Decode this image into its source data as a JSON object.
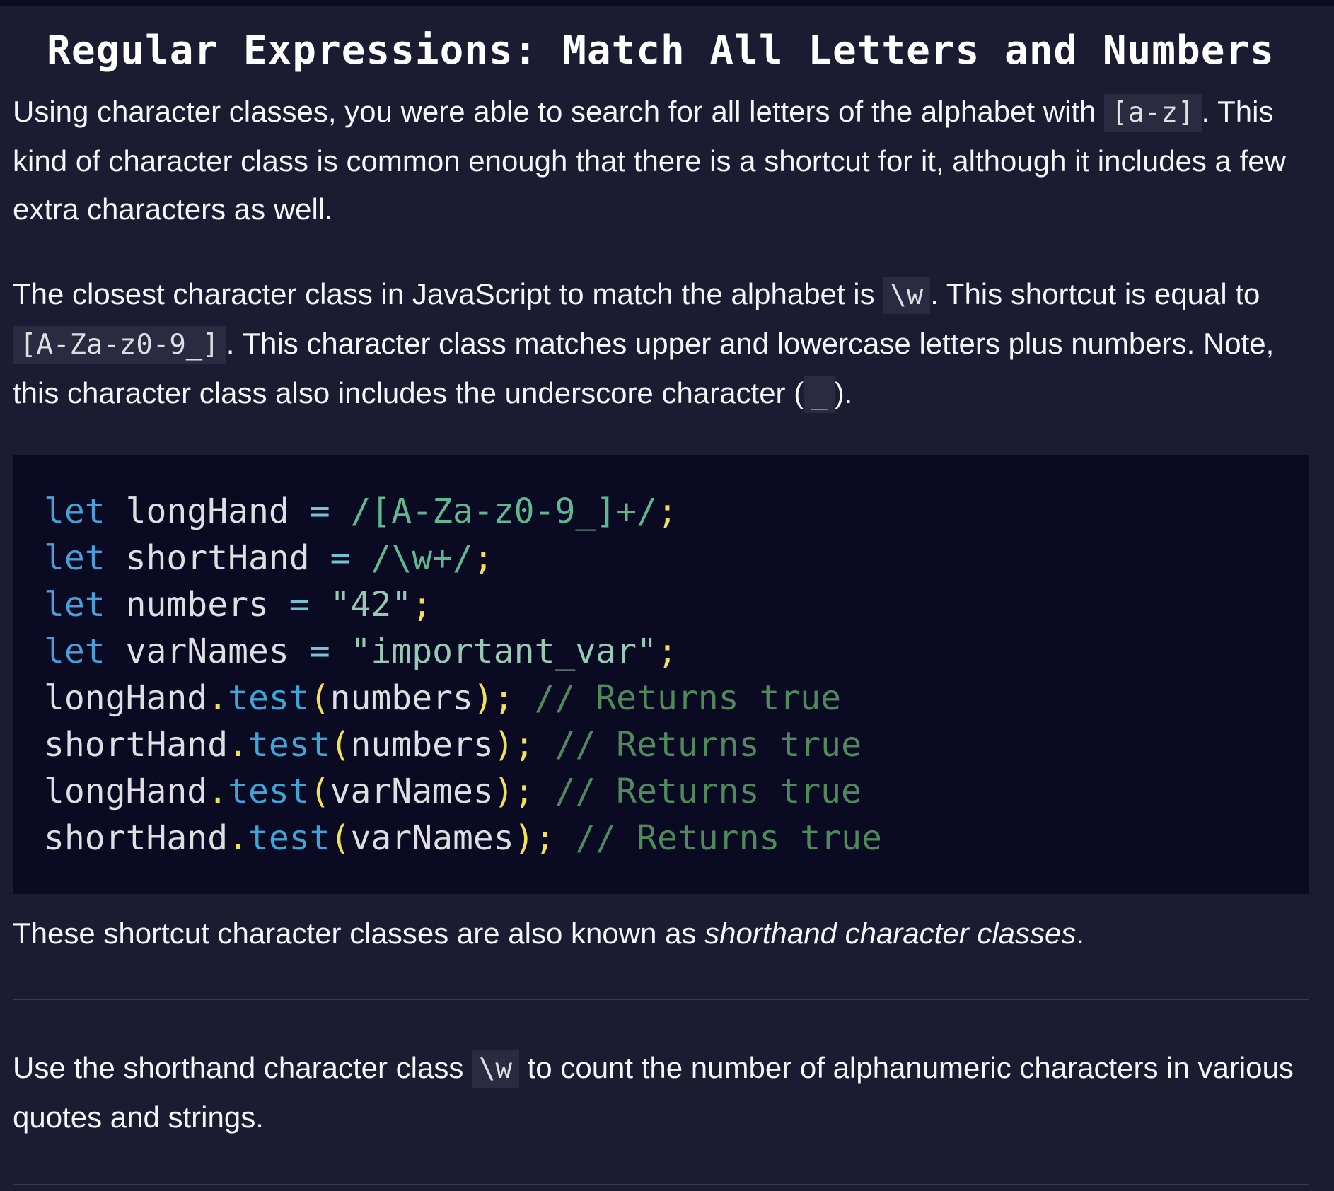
{
  "lesson": {
    "title": "Regular Expressions: Match All Letters and Numbers",
    "para1": {
      "t1": "Using character classes, you were able to search for all letters of the alphabet with ",
      "c1": "[a-z]",
      "t2": ". This kind of character class is common enough that there is a shortcut for it, although it includes a few extra characters as well."
    },
    "para2": {
      "t1": "The closest character class in JavaScript to match the alphabet is ",
      "c1": "\\w",
      "t2": ". This shortcut is equal to ",
      "c2": "[A-Za-z0-9_]",
      "t3": ". This character class matches upper and lowercase letters plus numbers. Note, this character class also includes the underscore character (",
      "c3": "_",
      "t4": ")."
    },
    "code": {
      "line1": {
        "kw": "let",
        "name": " longHand ",
        "op": "=",
        "val": " /[A-Za-z0-9_]+/",
        "end": ";"
      },
      "line2": {
        "kw": "let",
        "name": " shortHand ",
        "op": "=",
        "val": " /\\w+/",
        "end": ";"
      },
      "line3": {
        "kw": "let",
        "name": " numbers ",
        "op": "=",
        "val": " \"42\"",
        "end": ";"
      },
      "line4": {
        "kw": "let",
        "name": " varNames ",
        "op": "=",
        "val": " \"important_var\"",
        "end": ";"
      },
      "line5": {
        "obj": "longHand",
        "dot": ".",
        "fn": "test",
        "open": "(",
        "arg": "numbers",
        "close": ");",
        "cm": " // Returns true"
      },
      "line6": {
        "obj": "shortHand",
        "dot": ".",
        "fn": "test",
        "open": "(",
        "arg": "numbers",
        "close": ");",
        "cm": " // Returns true"
      },
      "line7": {
        "obj": "longHand",
        "dot": ".",
        "fn": "test",
        "open": "(",
        "arg": "varNames",
        "close": ");",
        "cm": " // Returns true"
      },
      "line8": {
        "obj": "shortHand",
        "dot": ".",
        "fn": "test",
        "open": "(",
        "arg": "varNames",
        "close": ");",
        "cm": " // Returns true"
      }
    },
    "para3": {
      "t1": "These shortcut character classes are also known as ",
      "em": "shorthand character classes",
      "t2": "."
    },
    "instructions": {
      "t1": "Use the shorthand character class ",
      "c1": "\\w",
      "t2": " to count the number of alphanumeric characters in various quotes and strings."
    }
  }
}
